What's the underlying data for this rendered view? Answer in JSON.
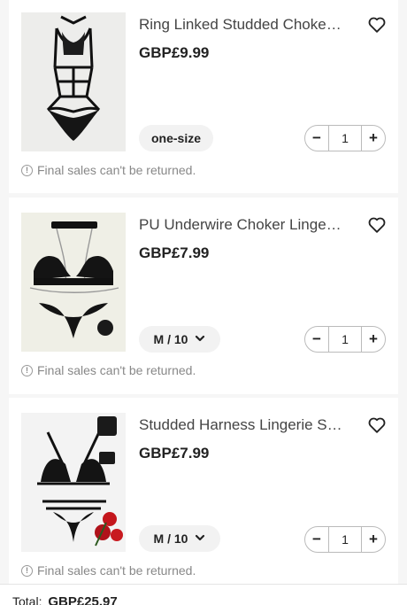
{
  "items": [
    {
      "title": "Ring Linked Studded Choker T...",
      "price": "GBP£9.99",
      "variant": "one-size",
      "quantity": "1",
      "notice": "Final sales can't be returned."
    },
    {
      "title": "PU Underwire Choker Lingerie ...",
      "price": "GBP£7.99",
      "variant": "M / 10",
      "quantity": "1",
      "notice": "Final sales can't be returned."
    },
    {
      "title": "Studded Harness Lingerie Set ...",
      "price": "GBP£7.99",
      "variant": "M / 10",
      "quantity": "1",
      "notice": "Final sales can't be returned."
    }
  ],
  "stepper": {
    "minus": "−",
    "plus": "+"
  },
  "footer": {
    "total_label": "Total:",
    "total_value": "GBP£25.97"
  },
  "icons": [
    "heart-icon",
    "chevron-down-icon",
    "info-icon",
    "minus-icon",
    "plus-icon"
  ],
  "colors": {
    "text": "#222222",
    "muted": "#888888",
    "border": "#bbbbbb",
    "chip": "#f2f2f2"
  }
}
